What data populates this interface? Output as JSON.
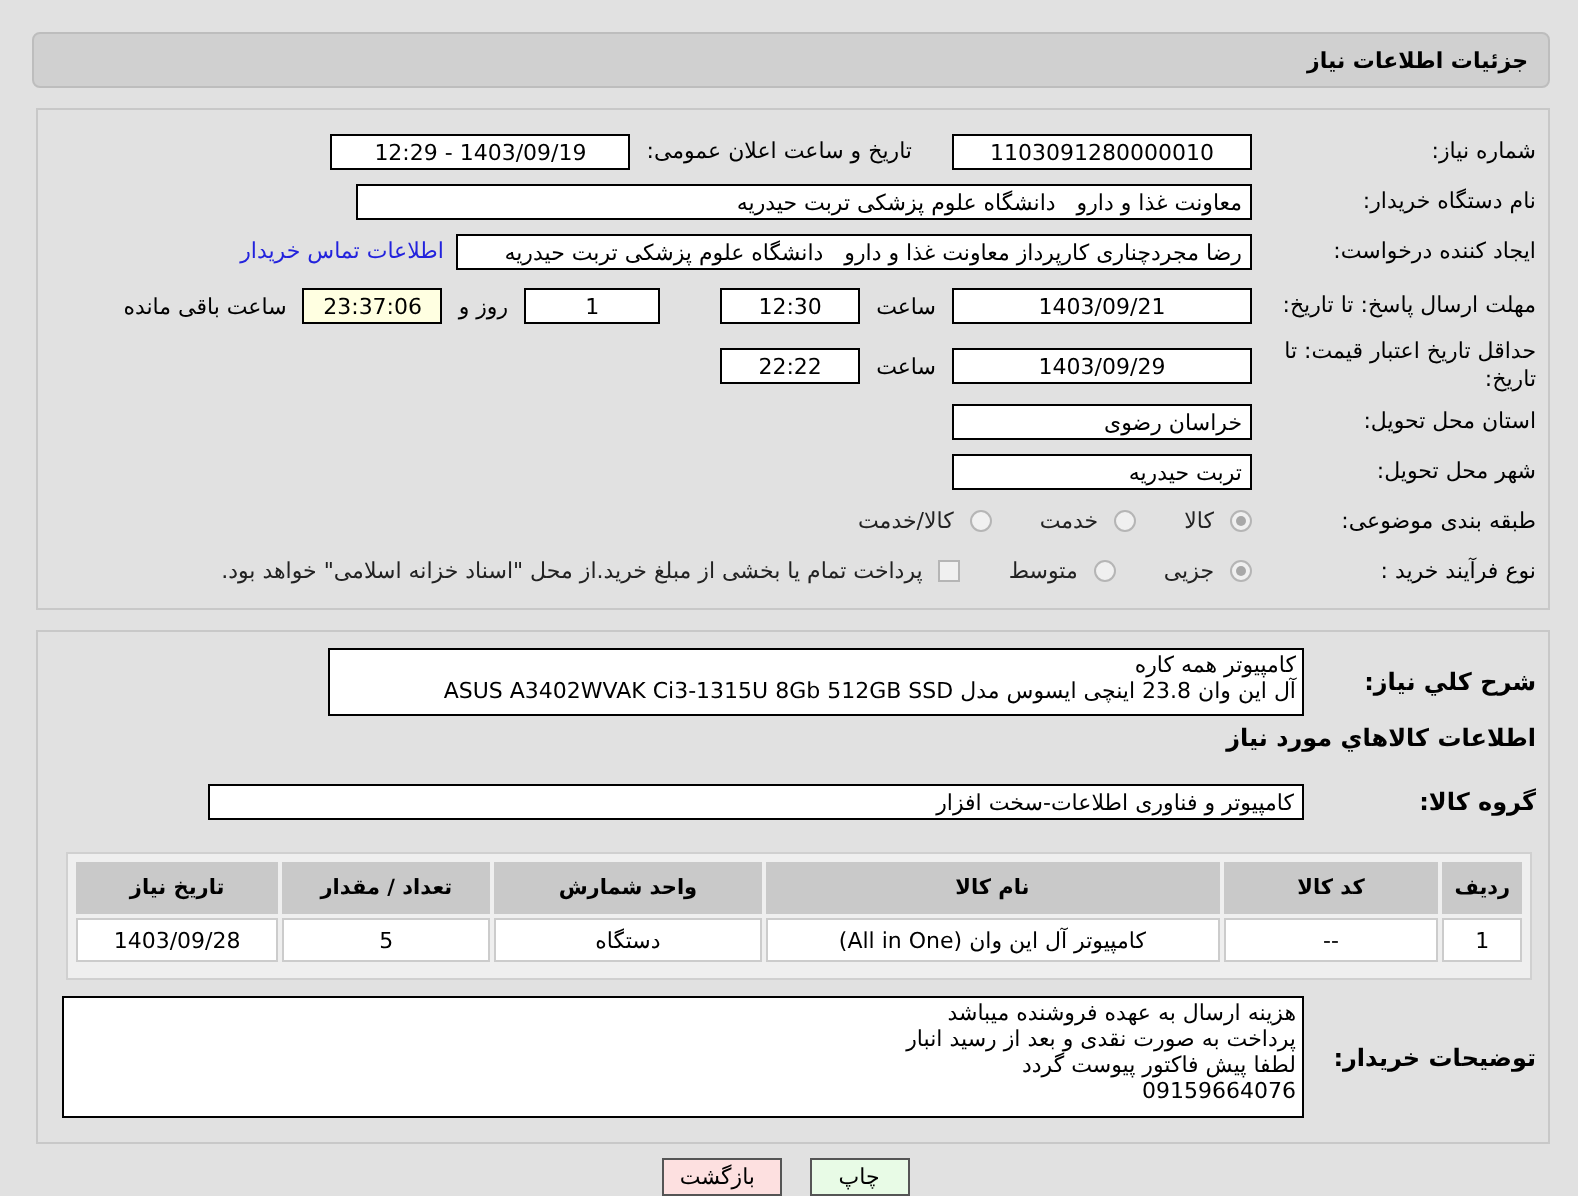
{
  "header": {
    "title": "جزئیات اطلاعات نیاز"
  },
  "need_number": {
    "label": "شماره نیاز:",
    "value": "1103091280000010"
  },
  "announce": {
    "label": "تاریخ و ساعت اعلان عمومی:",
    "value": "1403/09/19 - 12:29"
  },
  "buyer_org": {
    "label": "نام دستگاه خریدار:",
    "value": "معاونت غذا و دارو   دانشگاه علوم پزشکی تربت حیدریه"
  },
  "requester": {
    "label": "ایجاد کننده درخواست:",
    "value": "رضا مجردچناری کارپرداز معاونت غذا و دارو   دانشگاه علوم پزشکی تربت حیدریه",
    "link": "اطلاعات تماس خریدار"
  },
  "deadline": {
    "label": "مهلت ارسال پاسخ: تا تاریخ:",
    "date": "1403/09/21",
    "time_label": "ساعت",
    "time": "12:30",
    "days": "1",
    "days_label": "روز و",
    "remaining": "23:37:06",
    "remaining_label": "ساعت باقی مانده"
  },
  "validity": {
    "label": "حداقل تاریخ اعتبار قیمت: تا تاریخ:",
    "date": "1403/09/29",
    "time_label": "ساعت",
    "time": "22:22"
  },
  "province": {
    "label": "استان محل تحویل:",
    "value": "خراسان رضوی"
  },
  "city": {
    "label": "شهر محل تحویل:",
    "value": "تربت حیدریه"
  },
  "category": {
    "label": "طبقه بندی موضوعی:",
    "options": [
      {
        "label": "کالا",
        "selected": true
      },
      {
        "label": "خدمت",
        "selected": false
      },
      {
        "label": "کالا/خدمت",
        "selected": false
      }
    ]
  },
  "purchase_type": {
    "label": "نوع فرآیند خرید :",
    "options": [
      {
        "label": "جزیی",
        "selected": true
      },
      {
        "label": "متوسط",
        "selected": false
      }
    ],
    "payment": {
      "label": "پرداخت تمام یا بخشی از مبلغ خرید.از محل \"اسناد خزانه اسلامی\" خواهد بود.",
      "checked": false
    }
  },
  "description": {
    "label": "شرح کلي نياز:",
    "lines": [
      "کامپیوتر همه کاره",
      "آل این وان 23.8 اینچی ایسوس مدل ASUS A3402WVAK Ci3-1315U 8Gb 512GB SSD"
    ]
  },
  "items_title": "اطلاعات کالاهاي مورد نياز",
  "goods_group": {
    "label": "گروه کالا:",
    "value": "کامپیوتر و فناوری اطلاعات-سخت افزار"
  },
  "table": {
    "columns": [
      "ردیف",
      "کد کالا",
      "نام کالا",
      "واحد شمارش",
      "تعداد / مقدار",
      "تاریخ نیاز"
    ],
    "rows": [
      [
        "1",
        "--",
        "کامپیوتر آل این وان (All in One)",
        "دستگاه",
        "5",
        "1403/09/28"
      ]
    ]
  },
  "buyer_notes": {
    "label": "توضیحات خریدار:",
    "lines": [
      "هزینه ارسال به عهده فروشنده میباشد",
      "پرداخت به صورت نقدی و بعد از رسید انبار",
      "لطفا پیش فاکتور پیوست گردد",
      "09159664076"
    ]
  },
  "buttons": [
    {
      "label": "چاپ",
      "kind": "print"
    },
    {
      "label": "بازگشت",
      "kind": "back"
    }
  ]
}
